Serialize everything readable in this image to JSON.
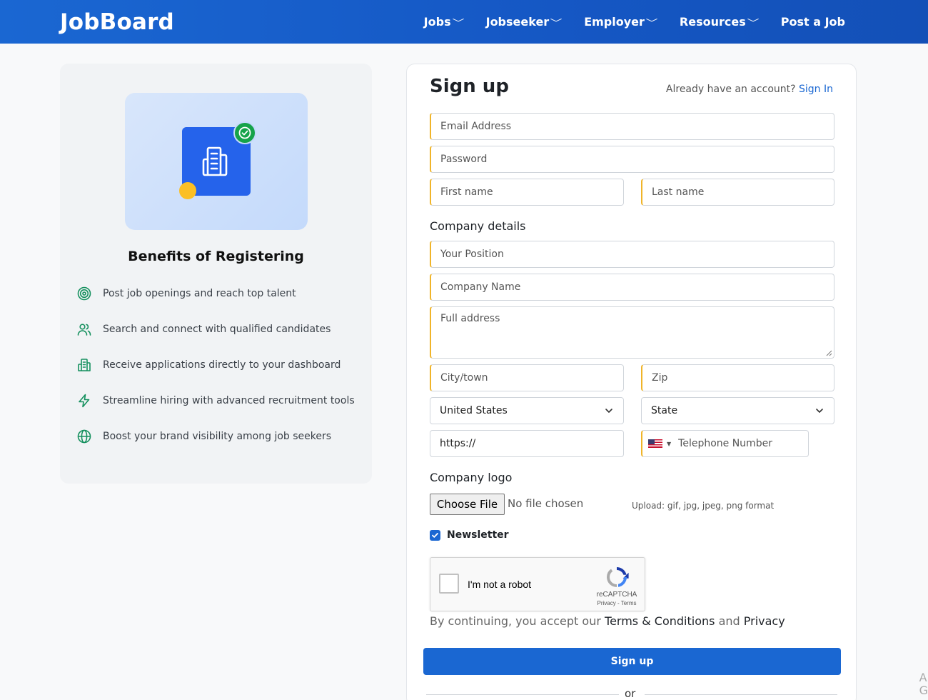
{
  "header": {
    "logo": "JobBoard",
    "nav": [
      {
        "label": "Jobs",
        "dropdown": true
      },
      {
        "label": "Jobseeker",
        "dropdown": true
      },
      {
        "label": "Employer",
        "dropdown": true
      },
      {
        "label": "Resources",
        "dropdown": true
      },
      {
        "label": "Post a Job",
        "dropdown": false
      }
    ]
  },
  "benefits": {
    "title": "Benefits of Registering",
    "items": [
      {
        "icon": "target-icon",
        "text": "Post job openings and reach top talent"
      },
      {
        "icon": "users-icon",
        "text": "Search and connect with qualified candidates"
      },
      {
        "icon": "building-icon",
        "text": "Receive applications directly to your dashboard"
      },
      {
        "icon": "lightning-icon",
        "text": "Streamline hiring with advanced recruitment tools"
      },
      {
        "icon": "globe-icon",
        "text": "Boost your brand visibility among job seekers"
      }
    ]
  },
  "form": {
    "title": "Sign up",
    "already_text": "Already have an account?",
    "signin_link": "Sign In",
    "email_placeholder": "Email Address",
    "password_placeholder": "Password",
    "first_name_placeholder": "First name",
    "last_name_placeholder": "Last name",
    "company_section": "Company details",
    "position_placeholder": "Your Position",
    "company_name_placeholder": "Company Name",
    "address_placeholder": "Full address",
    "city_placeholder": "City/town",
    "zip_placeholder": "Zip",
    "country_value": "United States",
    "state_value": "State",
    "website_value": "https://",
    "phone_placeholder": "Telephone Number",
    "logo_section": "Company logo",
    "file_button": "Choose File",
    "file_status": "No file chosen",
    "upload_hint": "Upload: gif, jpg, jpeg, png format",
    "newsletter_label": "Newsletter",
    "newsletter_checked": true,
    "captcha_label": "I'm not a robot",
    "captcha_brand": "reCAPTCHA",
    "captcha_links": "Privacy - Terms",
    "terms_prefix": "By continuing, you accept our",
    "terms_link": "Terms & Conditions",
    "terms_and": "and",
    "privacy_link": "Privacy",
    "submit_label": "Sign up",
    "or_text": "or"
  },
  "corner_text": "A\nG",
  "colors": {
    "brand": "#1a67d2",
    "accent_border": "#f0b429",
    "success": "#16a34a",
    "icon_green": "#15905e"
  }
}
